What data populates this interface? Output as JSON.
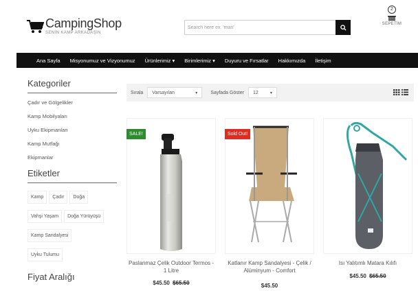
{
  "header": {
    "brand": "CampingShop",
    "tagline": "SENİN KAMP ARKADAŞIN",
    "search_placeholder": "Search here ex. 'man'",
    "cart_count": "2",
    "cart_label": "SEPETİM"
  },
  "nav": [
    "Ana Sayfa",
    "Misyonumuz ve Vizyonumuz",
    "Ürünlerimiz ▾",
    "Birimlerimiz ▾",
    "Duyuru ve Fırsatlar",
    "Hakkımızda",
    "İletişim"
  ],
  "sidebar": {
    "categories_title": "Kategoriler",
    "categories": [
      "Çadır ve Gölgelikler",
      "Kamp Mobilyaları",
      "Uyku Ekipmanları",
      "Kamp Mutfağı",
      "Ekipmanlar"
    ],
    "tags_title": "Etiketler",
    "tags": [
      "Kamp",
      "Çadır",
      "Doğa",
      "Vahşi Yaşam",
      "Doğa Yürüyüşü",
      "Kamp Sandalyesi",
      "Uyku Tulumu"
    ],
    "price_title": "Fiyat Aralığı"
  },
  "toolbar": {
    "sort_label": "Sırala",
    "sort_value": "Varsayılan",
    "show_label": "Sayfada Göster",
    "show_value": "12"
  },
  "products": [
    {
      "name": "Paslanmaz Çelik Outdoor Termos - 1 Litre",
      "price": "$45.50",
      "old_price": "$65.50",
      "badge": "SALE!",
      "badge_color": "#2e8b2e"
    },
    {
      "name": "Katlanır Kamp Sandalyesi - Çelik / Alüminyum - Comfort",
      "price": "$45.50",
      "old_price": "",
      "badge": "Sold Out!",
      "badge_color": "#e02b20"
    },
    {
      "name": "Isı Yalıtımlı Matara Kılıfı",
      "price": "$45.50",
      "old_price": "$65.50",
      "badge": "",
      "badge_color": ""
    }
  ],
  "colors": {
    "nav_bg": "#111111",
    "toolbar_bg": "#f2f2f2"
  }
}
